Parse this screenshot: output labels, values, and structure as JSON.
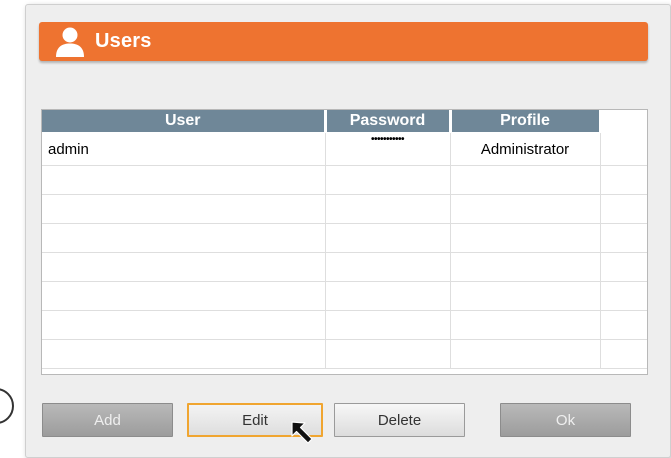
{
  "dialog": {
    "title": "Users",
    "accent_color": "#ee7330",
    "title_icon": "user-icon"
  },
  "table": {
    "header_color": "#6f8798",
    "columns": [
      "User",
      "Password",
      "Profile"
    ],
    "rows": [
      {
        "user": "admin",
        "password": "•••••••••••",
        "profile": "Administrator"
      }
    ],
    "empty_rows": 7
  },
  "buttons": {
    "add": {
      "label": "Add",
      "enabled": false
    },
    "edit": {
      "label": "Edit",
      "enabled": true,
      "focused": true
    },
    "delete": {
      "label": "Delete",
      "enabled": true
    },
    "ok": {
      "label": "Ok",
      "enabled": false
    }
  },
  "cursor": {
    "icon": "arrow-cursor-icon"
  }
}
